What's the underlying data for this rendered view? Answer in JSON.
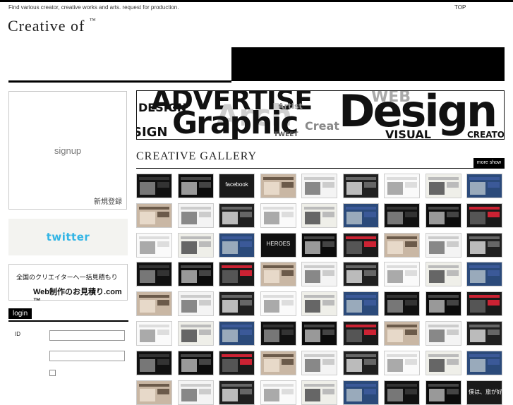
{
  "header": {
    "tagline": "Find various creator, creative works and arts. request for production.",
    "top_link": "TOP",
    "logo_text": "Creative of",
    "logo_tm": "™"
  },
  "sidebar": {
    "signup_label": "signup",
    "signup_jp": "新規登録",
    "twitter_label": "twitter",
    "estimate_line1": "全国のクリエイターへ一括見積もり",
    "estimate_line2": "Web制作のお見積り.com ™",
    "login_title": "login",
    "id_label": "ID",
    "id_value": "",
    "password_value": ""
  },
  "banner": {
    "words": [
      "ADVERTISE",
      "DESIGN",
      "Artist",
      "Arch",
      "Graphic",
      "Creat",
      "WEB",
      "Design",
      "VISUAL",
      "CREATO",
      "TWEET",
      "SIGN"
    ]
  },
  "gallery": {
    "title": "CREATIVE GALLERY",
    "more_label": "more show",
    "thumb_texts": [
      "facebook",
      "ReSee",
      "PURE.",
      "僕は、旅が好きだ。",
      "twitter",
      "HEROES",
      "PERSONALITY"
    ]
  },
  "colors": {
    "accent_black": "#000000",
    "twitter_blue": "#33b5e5",
    "border_gray": "#c8c8c8"
  }
}
